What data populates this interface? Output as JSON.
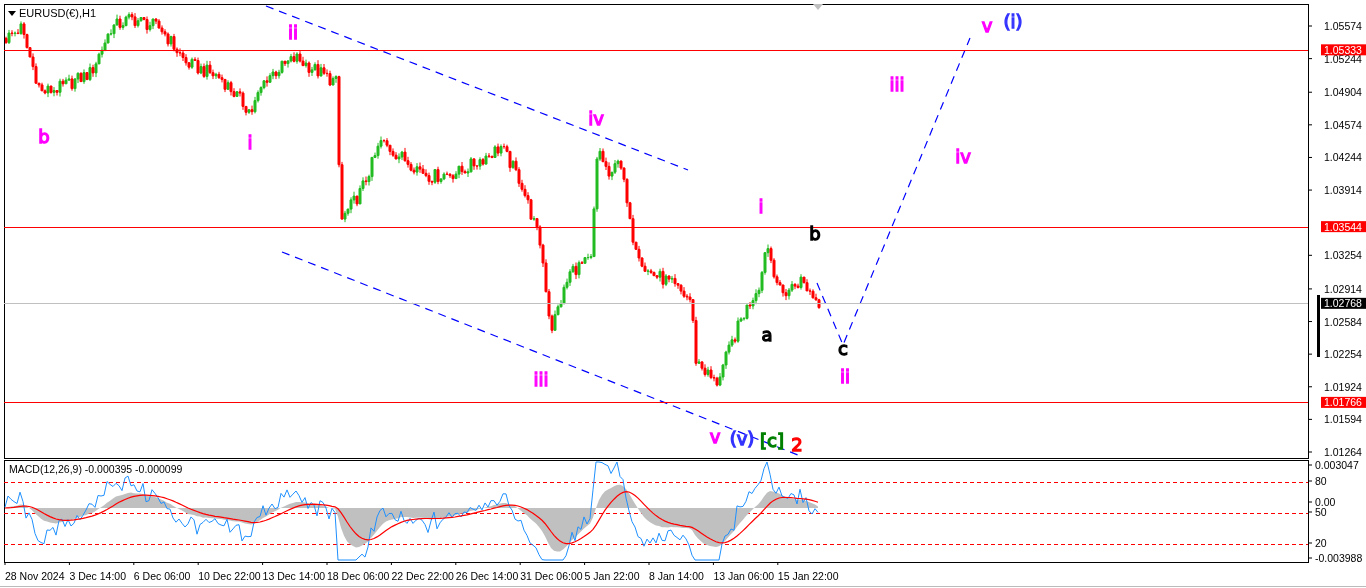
{
  "chart": {
    "symbol": "EURUSD(€),H1",
    "price_axis": [
      "1.05574",
      "1.05244",
      "1.04904",
      "1.04574",
      "1.04244",
      "1.03914",
      "1.03254",
      "1.02914",
      "1.02584",
      "1.02254",
      "1.01924",
      "1.01594",
      "1.01264"
    ],
    "levels": [
      {
        "price": "1.05333",
        "kind": "level"
      },
      {
        "price": "1.03544",
        "kind": "level"
      },
      {
        "price": "1.02768",
        "kind": "bid"
      },
      {
        "price": "1.01766",
        "kind": "level"
      }
    ],
    "wave_labels": [
      {
        "text": "b",
        "color": "#ff00ff"
      },
      {
        "text": "ii",
        "color": "#ff00ff"
      },
      {
        "text": "i",
        "color": "#ff00ff"
      },
      {
        "text": "iv",
        "color": "#ff00ff"
      },
      {
        "text": "iii",
        "color": "#ff00ff"
      },
      {
        "text": "v",
        "color": "#ff00ff"
      },
      {
        "text": "(v)",
        "color": "#3333ff"
      },
      {
        "text": "[c]",
        "color": "#008000"
      },
      {
        "text": "2",
        "color": "#ff0000"
      },
      {
        "text": "i",
        "color": "#ff00ff"
      },
      {
        "text": "b",
        "color": "#000000"
      },
      {
        "text": "a",
        "color": "#000000"
      },
      {
        "text": "c",
        "color": "#000000"
      },
      {
        "text": "ii",
        "color": "#ff00ff"
      },
      {
        "text": "iii",
        "color": "#ff00ff"
      },
      {
        "text": "iv",
        "color": "#ff00ff"
      },
      {
        "text": "v",
        "color": "#ff00ff"
      },
      {
        "text": "(i)",
        "color": "#3333ff"
      }
    ]
  },
  "indicator": {
    "title": "MACD(12,26,9) -0.000395 -0.000099",
    "axis": [
      "0.003047",
      "80",
      "0.00",
      "50",
      "20",
      "-0.003988"
    ]
  },
  "time_axis": [
    "28 Nov 2024",
    "3 Dec 14:00",
    "6 Dec 06:00",
    "10 Dec 22:00",
    "13 Dec 14:00",
    "18 Dec 06:00",
    "22 Dec 22:00",
    "26 Dec 14:00",
    "31 Dec 06:00",
    "5 Jan 22:00",
    "8 Jan 14:00",
    "13 Jan 06:00",
    "15 Jan 22:00"
  ]
}
